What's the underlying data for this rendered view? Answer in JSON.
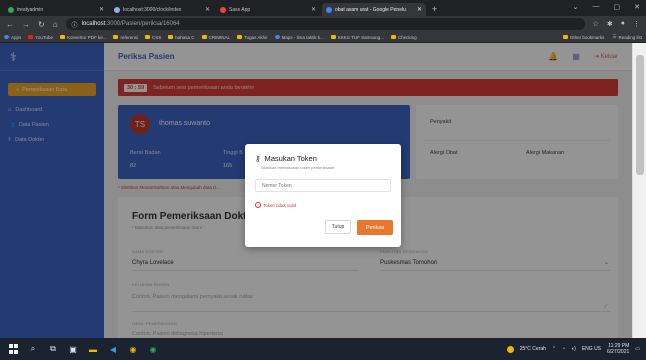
{
  "browser": {
    "tabs": [
      {
        "title": "treatyadmin",
        "color": "#34a853",
        "active": false
      },
      {
        "title": "localhost:3000/clock/index",
        "color": "#8ab4f8",
        "active": false
      },
      {
        "title": "Sass App",
        "color": "#ea4335",
        "active": false
      },
      {
        "title": "obat asam urat - Google Penelu",
        "color": "#4285f4",
        "active": true
      }
    ],
    "new_tab": "+",
    "url_host": "localhost",
    "url_path": ":3000/Pasien/periksa/16064",
    "bookmarks": [
      "Apps",
      "YouTube",
      "Konvertor PDF ke...",
      "referensi",
      "CSS",
      "bahasa C",
      "CRIMINAL",
      "Tugas Akhir",
      "Maps - lima taktik k...",
      "KKKS TUF Samsung...",
      "Checking"
    ],
    "bookmarks_right": [
      "Other bookmarks",
      "Reading list"
    ]
  },
  "sidebar": {
    "new_exam_button": "Pemeriksaan Baru",
    "items": [
      {
        "label": "Dashboard",
        "icon": "home-icon"
      },
      {
        "label": "Data Pasien",
        "icon": "users-icon"
      },
      {
        "label": "Data Dokter",
        "icon": "doctor-icon"
      }
    ]
  },
  "header": {
    "title": "Periksa Pasien",
    "logout": "Keluar"
  },
  "alert": {
    "timer": "30 : 59",
    "text": "Sebelum sesi pemeriksaan anda berakhir"
  },
  "patient": {
    "initials": "TS",
    "name": "thomas suwanto",
    "weight_label": "Berat Badan",
    "weight_value": "82",
    "height_label": "Tinggi B",
    "height_value": "165"
  },
  "info": {
    "disease": "Penyakit",
    "drug_allergy": "Alergi Obat",
    "food_allergy": "Alergi Makanan"
  },
  "required_note": "* Silahkan Menambahkan atau Mengubah data D...",
  "form": {
    "title": "Form Pemeriksaan Dokter",
    "subtitle": "* Masukan data pemeriksaan disini",
    "doctor_label": "Nama Dokter",
    "doctor_value": "Chyra Lovelace",
    "facility_label": "Fasilitas Kesehatan",
    "facility_value": "Puskesmas Tomohon",
    "complaint_label": "Keluhan Pasien",
    "complaint_placeholder": "Contoh: Pasien mengalami pernyakit sesak nafas",
    "diagnosis_label": "Hasil Pemeriksaan",
    "diagnosis_placeholder": "Contoh: Pasien didiagnosa hipertensi"
  },
  "modal": {
    "title": "Masukan Token",
    "description": "Silahkan memasukan token pemeriksaan",
    "input_placeholder": "Nomor Token",
    "error": "Token tidak valid",
    "close_button": "Tutup",
    "check_button": "Periksa"
  },
  "taskbar": {
    "weather": "25°C Cerah",
    "language": "ENG US",
    "time": "11:29 PM",
    "date": "6/27/2021"
  }
}
